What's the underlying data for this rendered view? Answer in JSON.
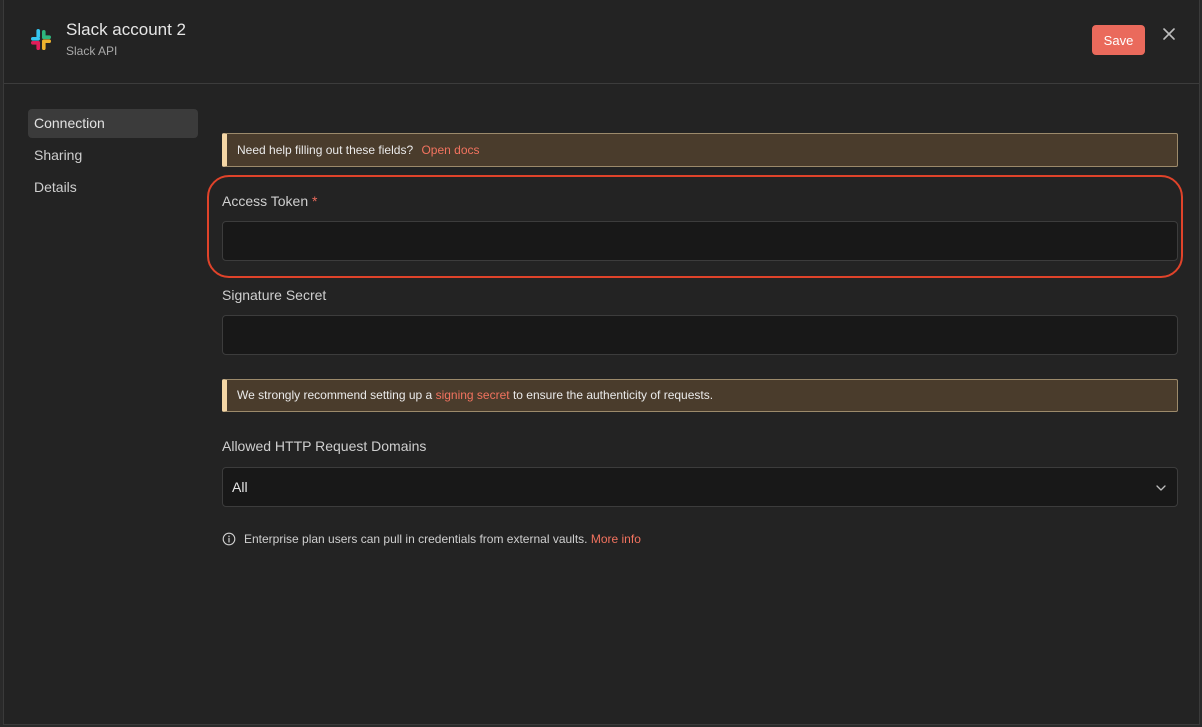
{
  "header": {
    "title": "Slack account 2",
    "subtitle": "Slack API",
    "save_label": "Save",
    "app_icon": "slack-logo",
    "close_icon": "close-icon"
  },
  "sidebar": {
    "items": [
      {
        "label": "Connection",
        "active": true
      },
      {
        "label": "Sharing",
        "active": false
      },
      {
        "label": "Details",
        "active": false
      }
    ]
  },
  "docs_banner": {
    "text": "Need help filling out these fields?",
    "link": "Open docs"
  },
  "fields": {
    "access_token": {
      "label": "Access Token",
      "required_marker": "*",
      "value": "",
      "placeholder": ""
    },
    "signature_secret": {
      "label": "Signature Secret",
      "value": "",
      "placeholder": ""
    }
  },
  "signing_banner": {
    "text_before": "We strongly recommend setting up a",
    "link": "signing secret",
    "text_after": "to ensure the authenticity of requests."
  },
  "domains": {
    "label": "Allowed HTTP Request Domains",
    "selected": "All"
  },
  "vault_note": {
    "text": "Enterprise plan users can pull in credentials from external vaults.",
    "link": "More info"
  },
  "colors": {
    "accent": "#ea6a5c",
    "link": "#f2735f",
    "highlight_ring": "#e0432a",
    "banner_bg": "#4a3c2c",
    "banner_stripe": "#f4d6a5"
  }
}
